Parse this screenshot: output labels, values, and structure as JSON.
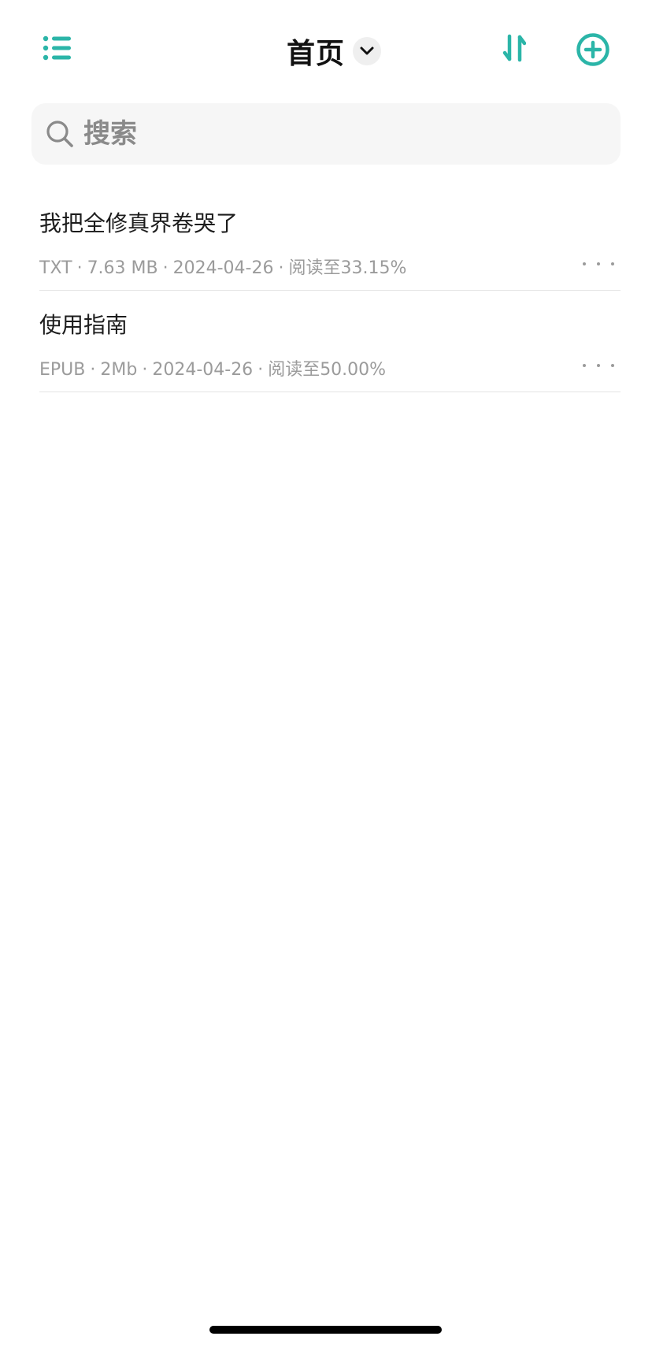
{
  "header": {
    "title": "首页",
    "menu_icon": "list-menu-icon",
    "title_dropdown_icon": "chevron-down-icon",
    "sort_icon": "sort-icon",
    "add_icon": "add-circle-icon",
    "accent_color": "#2BB5A8"
  },
  "search": {
    "placeholder": "搜索",
    "value": "",
    "icon": "search-icon"
  },
  "books": [
    {
      "title": "我把全修真界卷哭了",
      "format": "TXT",
      "size": "7.63 MB",
      "date": "2024-04-26",
      "progress": "阅读至33.15%"
    },
    {
      "title": "使用指南",
      "format": "EPUB",
      "size": "2Mb",
      "date": "2024-04-26",
      "progress": "阅读至50.00%"
    }
  ],
  "more_icon": "more-horizontal-icon"
}
